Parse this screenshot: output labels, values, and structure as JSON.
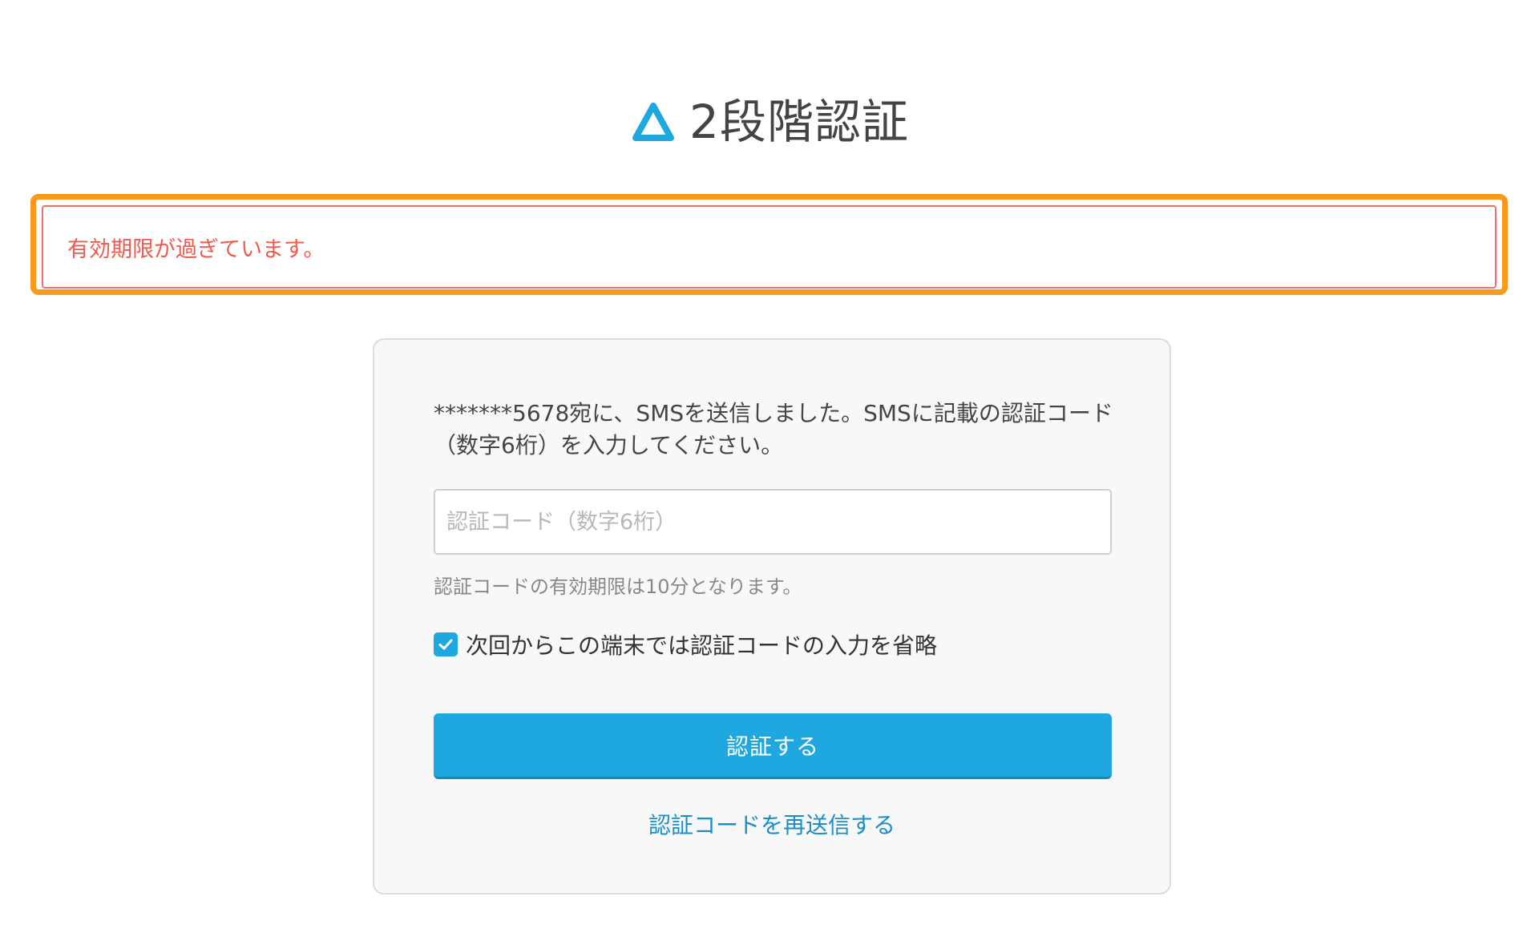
{
  "header": {
    "title": "2段階認証",
    "logo_icon": "triangle-logo-icon",
    "accent_color": "#1fa8e0"
  },
  "error": {
    "message": "有効期限が過ぎています。",
    "text_color": "#ef5a4e",
    "highlight_color": "#f89a1c"
  },
  "form": {
    "instructions": "*******5678宛に、SMSを送信しました。SMSに記載の認証コード（数字6桁）を入力してください。",
    "code_input": {
      "placeholder": "認証コード（数字6桁）",
      "value": ""
    },
    "hint": "認証コードの有効期限は10分となります。",
    "remember_device": {
      "label": "次回からこの端末では認証コードの入力を省略",
      "checked": true
    },
    "submit_label": "認証する",
    "resend_label": "認証コードを再送信する"
  }
}
